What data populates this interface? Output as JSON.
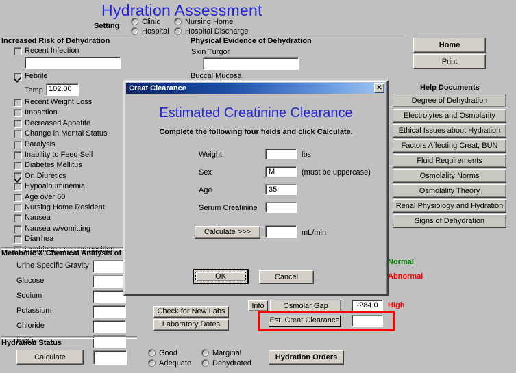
{
  "page_title": "Hydration Assessment",
  "setting": {
    "label": "Setting",
    "options": [
      {
        "label": "Clinic",
        "selected": false
      },
      {
        "label": "Nursing Home",
        "selected": false
      },
      {
        "label": "Hospital",
        "selected": false
      },
      {
        "label": "Hospital Discharge",
        "selected": false
      }
    ]
  },
  "risk_section": {
    "title": "Increased Risk of Dehydration",
    "recent_infection": {
      "label": "Recent Infection",
      "checked": false,
      "note_value": ""
    },
    "febrile": {
      "label": "Febrile",
      "checked": true
    },
    "temp": {
      "label": "Temp",
      "value": "102.00"
    },
    "items": [
      {
        "label": "Recent Weight Loss",
        "checked": false
      },
      {
        "label": "Impaction",
        "checked": false
      },
      {
        "label": "Decreased Appetite",
        "checked": false
      },
      {
        "label": "Change in Mental Status",
        "checked": false
      },
      {
        "label": "Paralysis",
        "checked": false
      },
      {
        "label": "Inability to Feed Self",
        "checked": false
      },
      {
        "label": "Diabetes Mellitus",
        "checked": false
      },
      {
        "label": "On Diuretics",
        "checked": true
      },
      {
        "label": "Hypoalbuminemia",
        "checked": false
      },
      {
        "label": "Age over 60",
        "checked": false
      },
      {
        "label": "Nursing Home Resident",
        "checked": false
      },
      {
        "label": "Nausea",
        "checked": false
      },
      {
        "label": "Nausea w/vomitting",
        "checked": false
      },
      {
        "label": "Diarrhea",
        "checked": false
      },
      {
        "label": "Unable to turn and position",
        "checked": false
      }
    ]
  },
  "physical_section": {
    "title": "Physical Evidence of Dehydration",
    "skin_turgor": {
      "label": "Skin Turgor",
      "value": ""
    },
    "buccal_mucosa": {
      "label": "Buccal Mucosa"
    }
  },
  "metabolic_section": {
    "title": "Metabolic & Chemical Analysis of",
    "rows": [
      {
        "label": "Urine Specific Gravity",
        "value": ""
      },
      {
        "label": "Glucose",
        "value": ""
      },
      {
        "label": "Sodium",
        "value": ""
      },
      {
        "label": "Potassium",
        "value": ""
      },
      {
        "label": "Chloride",
        "value": ""
      },
      {
        "label": "HCO",
        "sub": "3",
        "value": ""
      }
    ]
  },
  "hydration_status": {
    "title": "Hydration Status",
    "calculate_label": "Calculate",
    "value": "",
    "options": [
      {
        "label": "Good",
        "selected": false
      },
      {
        "label": "Marginal",
        "selected": false
      },
      {
        "label": "Adequate",
        "selected": false
      },
      {
        "label": "Dehydrated",
        "selected": false
      }
    ],
    "orders_label": "Hydration Orders"
  },
  "labs": {
    "check_new_labs_label": "Check for New Labs",
    "laboratory_dates_label": "Laboratory Dates"
  },
  "results": {
    "info_label": "Info",
    "osmolar_gap_label": "Osmolar Gap",
    "osmolar_gap_value": "-284.0",
    "osmolar_gap_flag": "High",
    "est_creat_label": "Est. Creat Clearance",
    "est_creat_value": "",
    "legend_normal": "Normal",
    "legend_abnormal": "Abnormal"
  },
  "sidebar": {
    "home_label": "Home",
    "print_label": "Print",
    "help_title": "Help Documents",
    "help_items": [
      "Degree of Dehydration",
      "Electrolytes and Osmolarity",
      "Ethical Issues about Hydration",
      "Factors Affecting Creat, BUN",
      "Fluid Requirements",
      "Osmolality Norms",
      "Osmolality Theory",
      "Renal Physiology and Hydration",
      "Signs of Dehydration"
    ]
  },
  "dialog": {
    "title": "Creat Clearance",
    "close_glyph": "✕",
    "heading": "Estimated Creatinine Clearance",
    "subheading": "Complete the following four fields and click Calculate.",
    "fields": [
      {
        "label": "Weight",
        "value": "",
        "unit": "lbs"
      },
      {
        "label": "Sex",
        "value": "M",
        "unit": "(must be uppercase)"
      },
      {
        "label": "Age",
        "value": "35",
        "unit": ""
      },
      {
        "label": "Serum Creatinine",
        "value": "",
        "unit": ""
      }
    ],
    "calculate_label": "Calculate  >>>",
    "result_value": "",
    "result_unit": "mL/min",
    "ok_label": "OK",
    "cancel_label": "Cancel"
  },
  "colors": {
    "title_blue": "#2424d8",
    "normal_green": "#008000",
    "abnormal_red": "#ff0000",
    "annotation_red": "#ff0000",
    "window_gray": "#c0c0c0"
  }
}
